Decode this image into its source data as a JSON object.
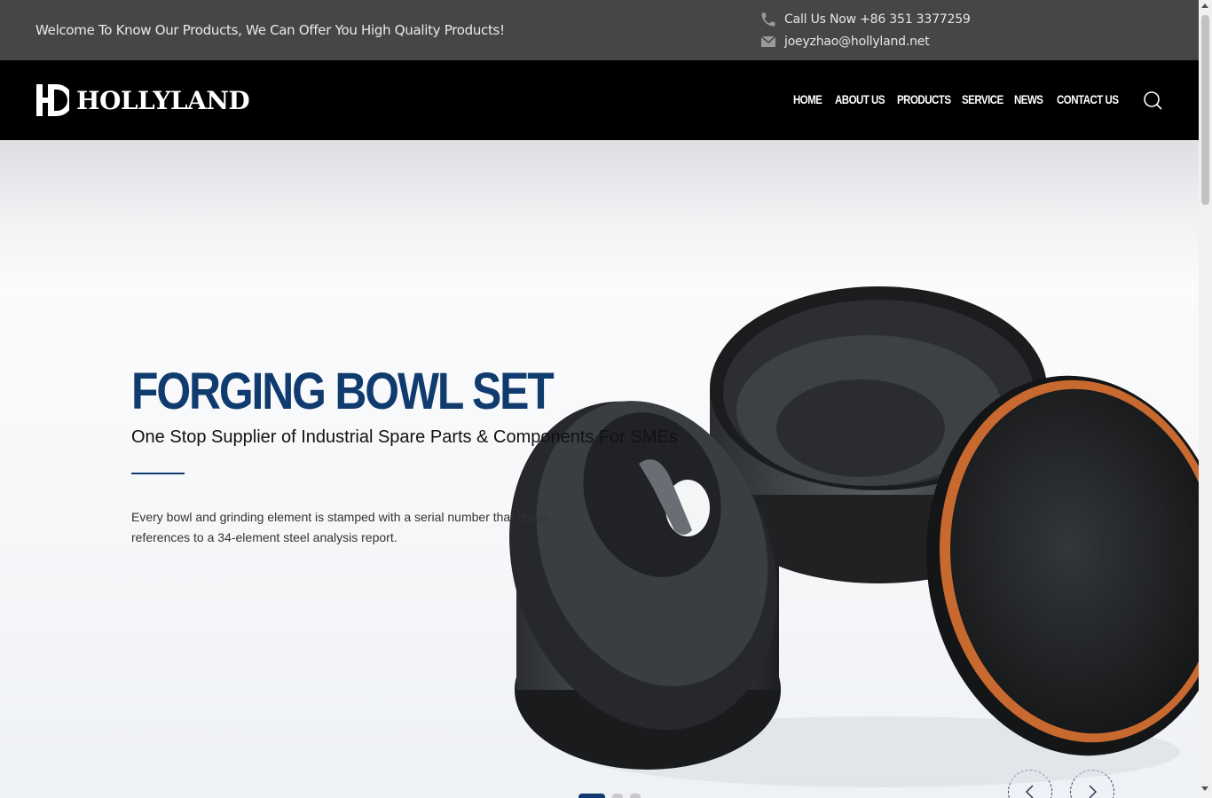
{
  "topbar": {
    "welcome": "Welcome To Know Our Products, We Can Offer You High Quality Products!",
    "phone_text": "Call Us Now +86 351 3377259",
    "email_text": "joeyzhao@hollyland.net",
    "phone_icon": "phone-icon",
    "email_icon": "mail-icon"
  },
  "header": {
    "logo_text": "HOLLYLAND",
    "nav": [
      "HOME",
      "ABOUT US",
      "PRODUCTS",
      "SERVICE",
      "NEWS",
      "CONTACT US"
    ],
    "search_icon": "search-icon"
  },
  "hero": {
    "title": "FORGING BOWL SET",
    "subtitle": "One Stop Supplier of Industrial Spare Parts & Components For SMEs",
    "description": "Every bowl and grinding element is stamped with a serial number that cross-references to a 34-element steel analysis report.",
    "slides_total": 3,
    "active_slide": 1
  },
  "colors": {
    "topbar_bg": "#464646",
    "nav_bg": "#000000",
    "accent": "#0f3b6e"
  }
}
